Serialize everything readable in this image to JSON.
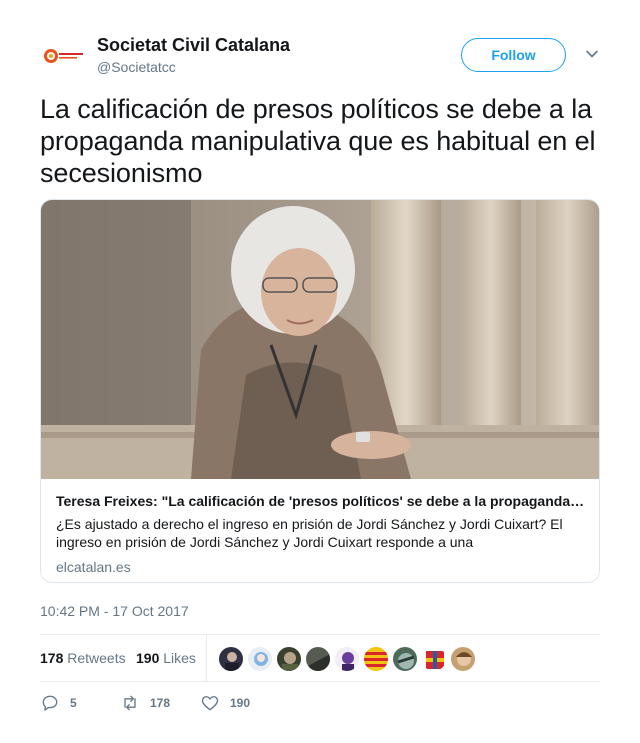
{
  "author": {
    "name": "Societat Civil Catalana",
    "handle": "@Societatcc",
    "follow_label": "Follow"
  },
  "tweet": {
    "text": "La calificación de presos políticos se debe a la propaganda manipulativa que es habitual en el secesionismo"
  },
  "card": {
    "title": "Teresa Freixes: \"La calificación de 'presos políticos' se debe a la propaganda…",
    "description": "¿Es ajustado a derecho el ingreso en prisión de Jordi Sánchez y Jordi Cuixart? El ingreso en prisión de Jordi Sánchez y Jordi Cuixart responde a una",
    "domain": "elcatalan.es"
  },
  "timestamp": "10:42 PM - 17 Oct 2017",
  "stats": {
    "retweets_count": "178",
    "retweets_label": "Retweets",
    "likes_count": "190",
    "likes_label": "Likes"
  },
  "actions": {
    "replies": "5",
    "retweets": "178",
    "likes": "190"
  },
  "colors": {
    "accent": "#1da1f2",
    "text": "#14171a",
    "muted": "#657786",
    "border": "#e1e8ed"
  },
  "icons": {
    "reply": "reply-icon",
    "retweet": "retweet-icon",
    "like": "heart-icon",
    "menu": "chevron-down-icon"
  }
}
